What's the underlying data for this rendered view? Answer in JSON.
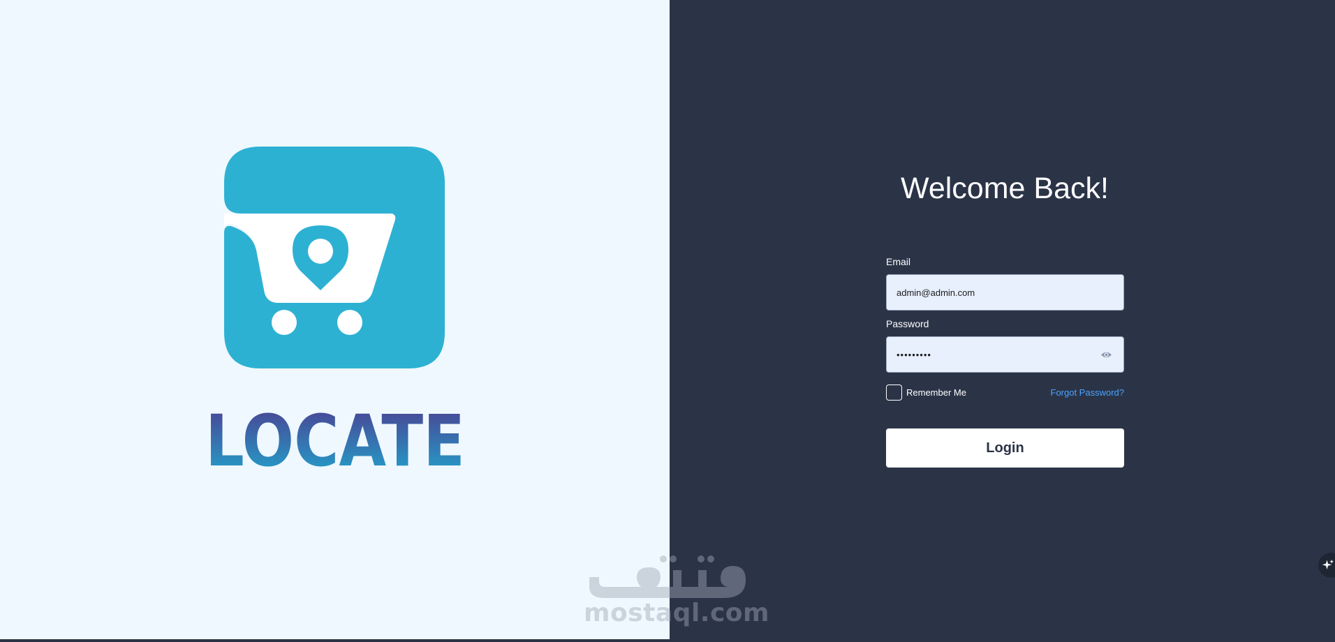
{
  "brand": {
    "wordmark": "LOCATE",
    "logo_icon": "cart-location-pin-icon"
  },
  "login": {
    "title": "Welcome Back!",
    "email_label": "Email",
    "email_value": "admin@admin.com",
    "password_label": "Password",
    "password_value": "•••••••••",
    "password_toggle_icon": "eye-icon",
    "remember_label": "Remember Me",
    "remember_checked": false,
    "forgot_label": "Forgot Password?",
    "login_label": "Login"
  },
  "watermark": {
    "text": "mostaql.com"
  },
  "assistant": {
    "icon": "sparkle-icon"
  },
  "colors": {
    "brand_cyan": "#2db1d3",
    "brand_purple": "#4e3b8f",
    "panel_dark": "#2b3447",
    "panel_light": "#eff8fe",
    "link_blue": "#4aa3ff",
    "input_fill": "#e8f0fe"
  }
}
